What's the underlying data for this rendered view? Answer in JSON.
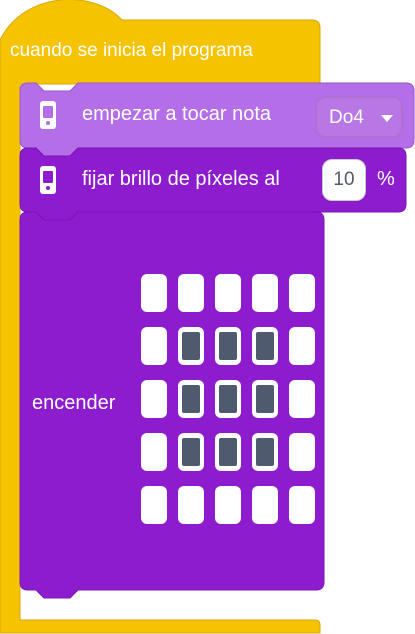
{
  "hat_block": {
    "label": "cuando se inicia el programa",
    "color": "#f6c300",
    "border": "#d7a800"
  },
  "note_block": {
    "label": "empezar a tocar nota",
    "dropdown_value": "Do4",
    "icon": "hub-icon",
    "color": "#b46ee8",
    "border": "#9a55cc"
  },
  "brightness_block": {
    "label": "fijar brillo de píxeles al",
    "value": "10",
    "unit": "%",
    "icon": "hub-icon",
    "color": "#8e1ccf"
  },
  "light_block": {
    "label": "encender",
    "color": "#8e1ccf",
    "matrix": [
      [
        0,
        0,
        0,
        0,
        0
      ],
      [
        0,
        1,
        1,
        1,
        0
      ],
      [
        0,
        1,
        1,
        1,
        0
      ],
      [
        0,
        1,
        1,
        1,
        0
      ],
      [
        0,
        0,
        0,
        0,
        0
      ]
    ]
  }
}
